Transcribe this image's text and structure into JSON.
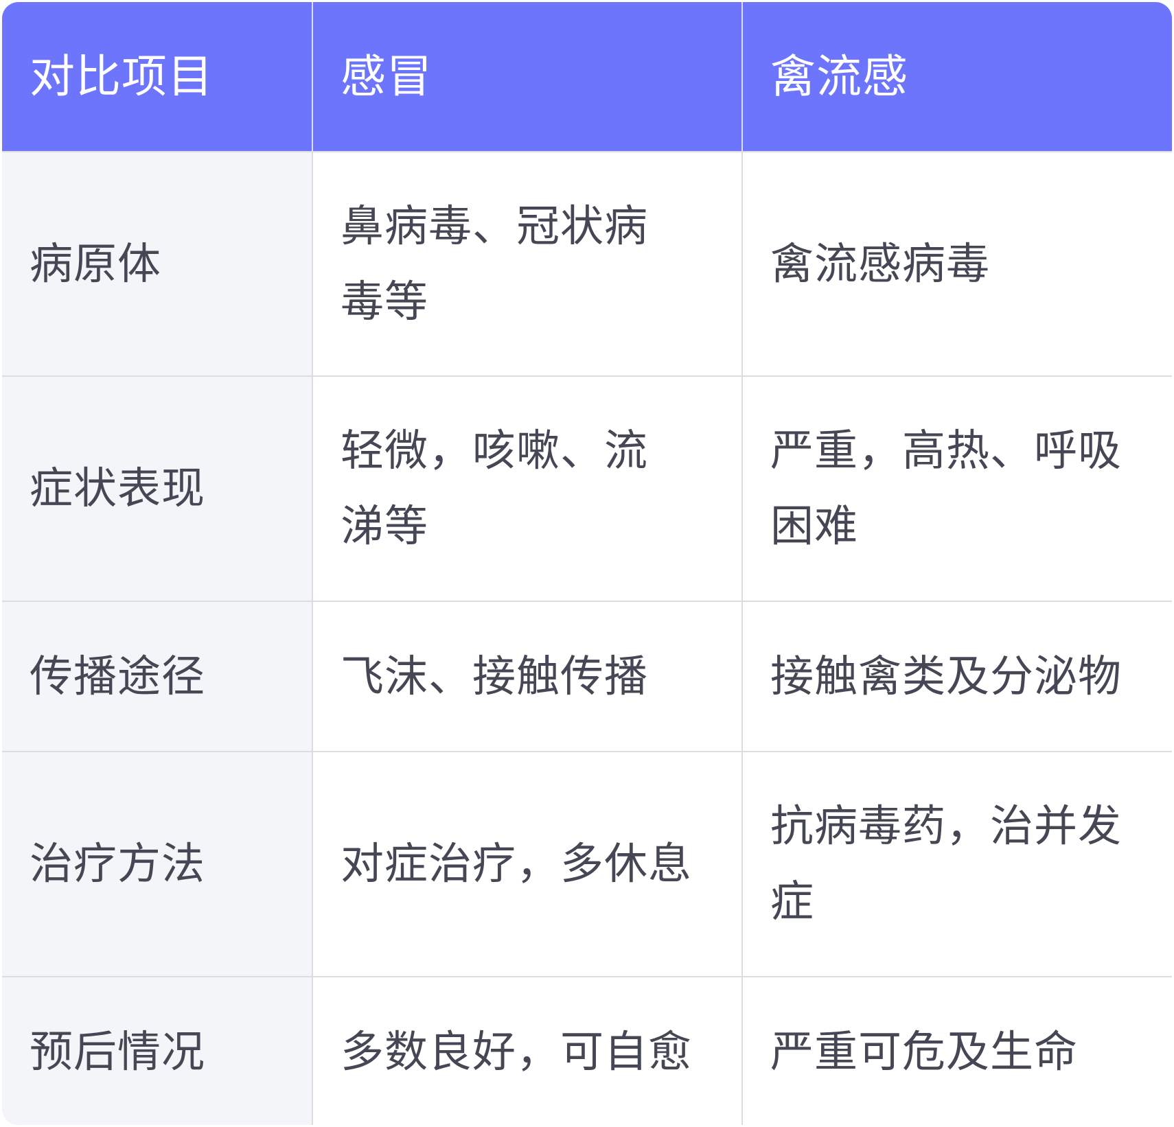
{
  "table": {
    "headers": [
      "对比项目",
      "感冒",
      "禽流感"
    ],
    "rows": [
      {
        "item": "病原体",
        "cold": "鼻病毒、冠状病毒等",
        "avian_flu": "禽流感病毒"
      },
      {
        "item": "症状表现",
        "cold": "轻微，咳嗽、流涕等",
        "avian_flu": "严重，高热、呼吸困难"
      },
      {
        "item": "传播途径",
        "cold": "飞沫、接触传播",
        "avian_flu": "接触禽类及分泌物"
      },
      {
        "item": "治疗方法",
        "cold": "对症治疗，多休息",
        "avian_flu": "抗病毒药，治并发症"
      },
      {
        "item": "预后情况",
        "cold": "多数良好，可自愈",
        "avian_flu": "严重可危及生命"
      }
    ]
  },
  "colors": {
    "header_bg": "#6e75fd",
    "label_bg": "#f4f5f9",
    "cell_bg": "#ffffff",
    "border": "#dcdde3",
    "text": "#454854"
  }
}
